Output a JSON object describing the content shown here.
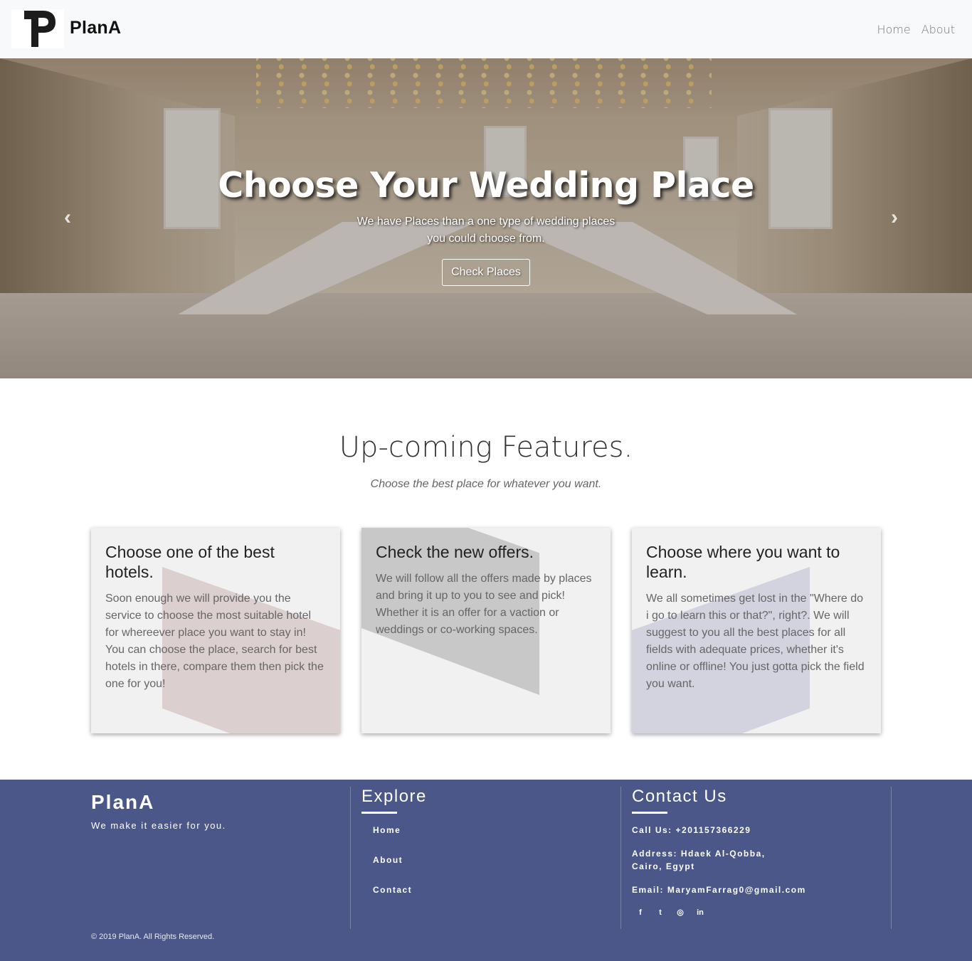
{
  "nav": {
    "brand": "PlanA",
    "links": [
      "Home",
      "About"
    ]
  },
  "hero": {
    "title": "Choose Your Wedding Place",
    "subtitle_line1": "We have Places than a one type of wedding places",
    "subtitle_line2": "you could choose from.",
    "button": "Check Places",
    "prev_arrow": "‹",
    "next_arrow": "›"
  },
  "features": {
    "title": "Up-coming Features.",
    "subtitle": "Choose the best place for whatever you want.",
    "cards": [
      {
        "title": "Choose one of the best hotels.",
        "text": "Soon enough we will provide you the service to choose the most suitable hotel for whereever place you want to stay in! You can choose the place, search for best hotels in there, compare them then pick the one for you!",
        "accent": "#dccfcf"
      },
      {
        "title": "Check the new offers.",
        "text": "We will follow all the offers made by places and bring it up to you to see and pick! Whether it is an offer for a vaction or weddings or co-working spaces.",
        "accent": "#c8c8c8"
      },
      {
        "title": "Choose where you want to learn.",
        "text": "We all sometimes get lost in the \"Where do i go to learn this or that?\", right?. We will suggest to you all the best places for all fields with adequate prices, whether it's online or offline! You just gotta pick the field you want.",
        "accent": "#d2d3de"
      }
    ]
  },
  "footer": {
    "brand": "PlanA",
    "tagline": "We make it easier for you.",
    "explore": {
      "heading": "Explore",
      "links": [
        "Home",
        "About",
        "Contact"
      ]
    },
    "contact": {
      "heading": "Contact Us",
      "phone": "Call Us: +201157366229",
      "address_line1": "Address: Hdaek Al-Qobba,",
      "address_line2": "Cairo, Egypt",
      "email": "Email: MaryamFarrag0@gmail.com"
    },
    "social": [
      "facebook-icon",
      "twitter-icon",
      "instagram-icon",
      "linkedin-icon"
    ],
    "social_glyphs": [
      "f",
      "t",
      "◎",
      "in"
    ],
    "copyright": "© 2019 PlanA. All Rights Reserved.",
    "background": "#4a5788"
  }
}
